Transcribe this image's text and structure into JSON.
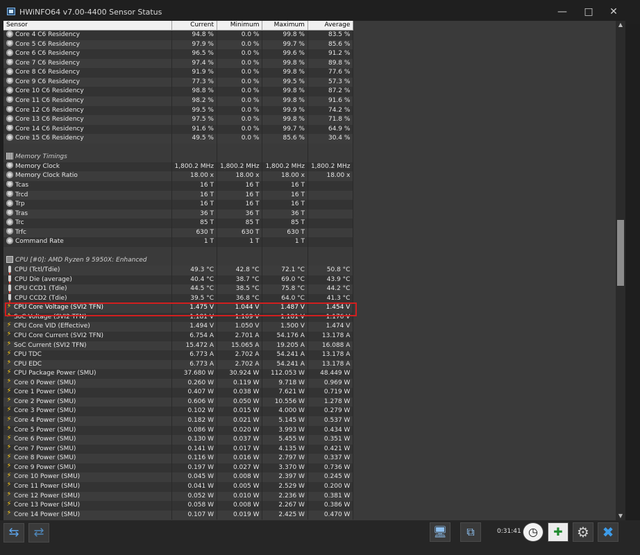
{
  "window": {
    "title": "HWiNFO64 v7.00-4400 Sensor Status"
  },
  "columns": {
    "sensor": "Sensor",
    "current": "Current",
    "minimum": "Minimum",
    "maximum": "Maximum",
    "average": "Average"
  },
  "rows": [
    {
      "type": "row",
      "icon": "clock",
      "name": "Core 4 C6 Residency",
      "cur": "94.8 %",
      "min": "0.0 %",
      "max": "99.8 %",
      "avg": "83.5 %"
    },
    {
      "type": "row",
      "icon": "clock",
      "name": "Core 5 C6 Residency",
      "cur": "97.9 %",
      "min": "0.0 %",
      "max": "99.7 %",
      "avg": "85.6 %"
    },
    {
      "type": "row",
      "icon": "clock",
      "name": "Core 6 C6 Residency",
      "cur": "96.5 %",
      "min": "0.0 %",
      "max": "99.6 %",
      "avg": "91.2 %"
    },
    {
      "type": "row",
      "icon": "clock",
      "name": "Core 7 C6 Residency",
      "cur": "97.4 %",
      "min": "0.0 %",
      "max": "99.8 %",
      "avg": "89.8 %"
    },
    {
      "type": "row",
      "icon": "clock",
      "name": "Core 8 C6 Residency",
      "cur": "91.9 %",
      "min": "0.0 %",
      "max": "99.8 %",
      "avg": "77.6 %"
    },
    {
      "type": "row",
      "icon": "clock",
      "name": "Core 9 C6 Residency",
      "cur": "77.3 %",
      "min": "0.0 %",
      "max": "99.5 %",
      "avg": "57.3 %"
    },
    {
      "type": "row",
      "icon": "clock",
      "name": "Core 10 C6 Residency",
      "cur": "98.8 %",
      "min": "0.0 %",
      "max": "99.8 %",
      "avg": "87.2 %"
    },
    {
      "type": "row",
      "icon": "clock",
      "name": "Core 11 C6 Residency",
      "cur": "98.2 %",
      "min": "0.0 %",
      "max": "99.8 %",
      "avg": "91.6 %"
    },
    {
      "type": "row",
      "icon": "clock",
      "name": "Core 12 C6 Residency",
      "cur": "99.5 %",
      "min": "0.0 %",
      "max": "99.9 %",
      "avg": "74.2 %"
    },
    {
      "type": "row",
      "icon": "clock",
      "name": "Core 13 C6 Residency",
      "cur": "97.5 %",
      "min": "0.0 %",
      "max": "99.8 %",
      "avg": "71.8 %"
    },
    {
      "type": "row",
      "icon": "clock",
      "name": "Core 14 C6 Residency",
      "cur": "91.6 %",
      "min": "0.0 %",
      "max": "99.7 %",
      "avg": "64.9 %"
    },
    {
      "type": "row",
      "icon": "clock",
      "name": "Core 15 C6 Residency",
      "cur": "49.5 %",
      "min": "0.0 %",
      "max": "85.6 %",
      "avg": "30.4 %"
    },
    {
      "type": "blank"
    },
    {
      "type": "group",
      "icon": "memory",
      "name": "Memory Timings"
    },
    {
      "type": "row",
      "icon": "clock",
      "name": "Memory Clock",
      "cur": "1,800.2 MHz",
      "min": "1,800.2 MHz",
      "max": "1,800.2 MHz",
      "avg": "1,800.2 MHz"
    },
    {
      "type": "row",
      "icon": "clock",
      "name": "Memory Clock Ratio",
      "cur": "18.00 x",
      "min": "18.00 x",
      "max": "18.00 x",
      "avg": "18.00 x"
    },
    {
      "type": "row",
      "icon": "clock",
      "name": "Tcas",
      "cur": "16 T",
      "min": "16 T",
      "max": "16 T",
      "avg": ""
    },
    {
      "type": "row",
      "icon": "clock",
      "name": "Trcd",
      "cur": "16 T",
      "min": "16 T",
      "max": "16 T",
      "avg": ""
    },
    {
      "type": "row",
      "icon": "clock",
      "name": "Trp",
      "cur": "16 T",
      "min": "16 T",
      "max": "16 T",
      "avg": ""
    },
    {
      "type": "row",
      "icon": "clock",
      "name": "Tras",
      "cur": "36 T",
      "min": "36 T",
      "max": "36 T",
      "avg": ""
    },
    {
      "type": "row",
      "icon": "clock",
      "name": "Trc",
      "cur": "85 T",
      "min": "85 T",
      "max": "85 T",
      "avg": ""
    },
    {
      "type": "row",
      "icon": "clock",
      "name": "Trfc",
      "cur": "630 T",
      "min": "630 T",
      "max": "630 T",
      "avg": ""
    },
    {
      "type": "row",
      "icon": "clock",
      "name": "Command Rate",
      "cur": "1 T",
      "min": "1 T",
      "max": "1 T",
      "avg": ""
    },
    {
      "type": "blank"
    },
    {
      "type": "group",
      "icon": "cpu",
      "name": "CPU [#0]: AMD Ryzen 9 5950X: Enhanced"
    },
    {
      "type": "row",
      "icon": "thermo",
      "name": "CPU (Tctl/Tdie)",
      "cur": "49.3 °C",
      "min": "42.8 °C",
      "max": "72.1 °C",
      "avg": "50.8 °C"
    },
    {
      "type": "row",
      "icon": "thermo",
      "name": "CPU Die (average)",
      "cur": "40.4 °C",
      "min": "38.7 °C",
      "max": "69.0 °C",
      "avg": "43.9 °C"
    },
    {
      "type": "row",
      "icon": "thermo",
      "name": "CPU CCD1 (Tdie)",
      "cur": "44.5 °C",
      "min": "38.5 °C",
      "max": "75.8 °C",
      "avg": "44.2 °C"
    },
    {
      "type": "row",
      "icon": "thermo",
      "name": "CPU CCD2 (Tdie)",
      "cur": "39.5 °C",
      "min": "36.8 °C",
      "max": "64.0 °C",
      "avg": "41.3 °C"
    },
    {
      "type": "row",
      "icon": "bolt",
      "name": "CPU Core Voltage (SVI2 TFN)",
      "cur": "1.475 V",
      "min": "1.044 V",
      "max": "1.487 V",
      "avg": "1.454 V",
      "selected": true
    },
    {
      "type": "row",
      "icon": "bolt",
      "name": "SoC Voltage (SVI2 TFN)",
      "cur": "1.181 V",
      "min": "1.169 V",
      "max": "1.181 V",
      "avg": "1.176 V"
    },
    {
      "type": "row",
      "icon": "bolt",
      "name": "CPU Core VID (Effective)",
      "cur": "1.494 V",
      "min": "1.050 V",
      "max": "1.500 V",
      "avg": "1.474 V"
    },
    {
      "type": "row",
      "icon": "bolt",
      "name": "CPU Core Current (SVI2 TFN)",
      "cur": "6.754 A",
      "min": "2.701 A",
      "max": "54.176 A",
      "avg": "13.178 A"
    },
    {
      "type": "row",
      "icon": "bolt",
      "name": "SoC Current (SVI2 TFN)",
      "cur": "15.472 A",
      "min": "15.065 A",
      "max": "19.205 A",
      "avg": "16.088 A"
    },
    {
      "type": "row",
      "icon": "bolt",
      "name": "CPU TDC",
      "cur": "6.773 A",
      "min": "2.702 A",
      "max": "54.241 A",
      "avg": "13.178 A"
    },
    {
      "type": "row",
      "icon": "bolt",
      "name": "CPU EDC",
      "cur": "6.773 A",
      "min": "2.702 A",
      "max": "54.241 A",
      "avg": "13.178 A"
    },
    {
      "type": "row",
      "icon": "bolt",
      "name": "CPU Package Power (SMU)",
      "cur": "37.680 W",
      "min": "30.924 W",
      "max": "112.053 W",
      "avg": "48.449 W"
    },
    {
      "type": "row",
      "icon": "bolt",
      "name": "Core 0 Power (SMU)",
      "cur": "0.260 W",
      "min": "0.119 W",
      "max": "9.718 W",
      "avg": "0.969 W"
    },
    {
      "type": "row",
      "icon": "bolt",
      "name": "Core 1 Power (SMU)",
      "cur": "0.407 W",
      "min": "0.038 W",
      "max": "7.621 W",
      "avg": "0.719 W"
    },
    {
      "type": "row",
      "icon": "bolt",
      "name": "Core 2 Power (SMU)",
      "cur": "0.606 W",
      "min": "0.050 W",
      "max": "10.556 W",
      "avg": "1.278 W"
    },
    {
      "type": "row",
      "icon": "bolt",
      "name": "Core 3 Power (SMU)",
      "cur": "0.102 W",
      "min": "0.015 W",
      "max": "4.000 W",
      "avg": "0.279 W"
    },
    {
      "type": "row",
      "icon": "bolt",
      "name": "Core 4 Power (SMU)",
      "cur": "0.182 W",
      "min": "0.021 W",
      "max": "5.145 W",
      "avg": "0.537 W"
    },
    {
      "type": "row",
      "icon": "bolt",
      "name": "Core 5 Power (SMU)",
      "cur": "0.086 W",
      "min": "0.020 W",
      "max": "3.993 W",
      "avg": "0.434 W"
    },
    {
      "type": "row",
      "icon": "bolt",
      "name": "Core 6 Power (SMU)",
      "cur": "0.130 W",
      "min": "0.037 W",
      "max": "5.455 W",
      "avg": "0.351 W"
    },
    {
      "type": "row",
      "icon": "bolt",
      "name": "Core 7 Power (SMU)",
      "cur": "0.141 W",
      "min": "0.017 W",
      "max": "4.135 W",
      "avg": "0.421 W"
    },
    {
      "type": "row",
      "icon": "bolt",
      "name": "Core 8 Power (SMU)",
      "cur": "0.116 W",
      "min": "0.016 W",
      "max": "2.797 W",
      "avg": "0.337 W"
    },
    {
      "type": "row",
      "icon": "bolt",
      "name": "Core 9 Power (SMU)",
      "cur": "0.197 W",
      "min": "0.027 W",
      "max": "3.370 W",
      "avg": "0.736 W"
    },
    {
      "type": "row",
      "icon": "bolt",
      "name": "Core 10 Power (SMU)",
      "cur": "0.045 W",
      "min": "0.008 W",
      "max": "2.397 W",
      "avg": "0.245 W"
    },
    {
      "type": "row",
      "icon": "bolt",
      "name": "Core 11 Power (SMU)",
      "cur": "0.041 W",
      "min": "0.005 W",
      "max": "2.529 W",
      "avg": "0.200 W"
    },
    {
      "type": "row",
      "icon": "bolt",
      "name": "Core 12 Power (SMU)",
      "cur": "0.052 W",
      "min": "0.010 W",
      "max": "2.236 W",
      "avg": "0.381 W"
    },
    {
      "type": "row",
      "icon": "bolt",
      "name": "Core 13 Power (SMU)",
      "cur": "0.058 W",
      "min": "0.008 W",
      "max": "2.267 W",
      "avg": "0.386 W"
    },
    {
      "type": "row",
      "icon": "bolt",
      "name": "Core 14 Power (SMU)",
      "cur": "0.107 W",
      "min": "0.019 W",
      "max": "2.425 W",
      "avg": "0.470 W"
    }
  ],
  "footer": {
    "elapsed": "0:31:41"
  },
  "colors": {
    "selection": "#1e4f86",
    "highlight_border": "#d21f1f",
    "bolt": "#f5c518"
  },
  "icons": {
    "nav_left": "arrows-left-right-icon",
    "nav_right": "arrows-collapse-icon",
    "network": "network-icon",
    "reset_layout": "layout-icon",
    "clock": "clock-reset-icon",
    "report": "report-add-icon",
    "settings": "gear-icon",
    "close": "close-icon"
  }
}
